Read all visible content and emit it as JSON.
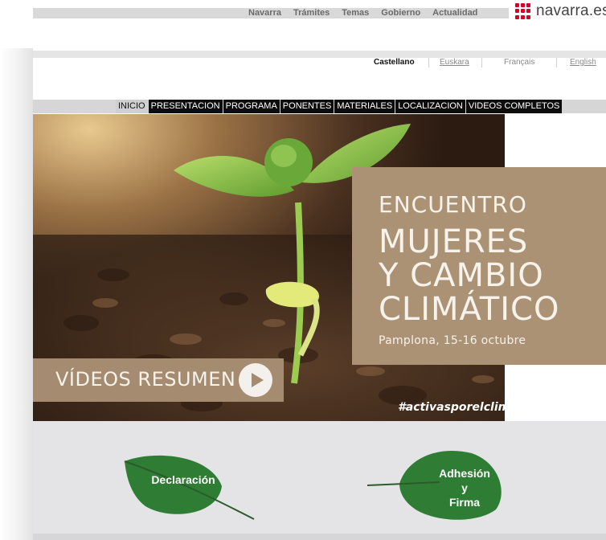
{
  "topnav": {
    "items": [
      "Navarra",
      "Trámites",
      "Temas",
      "Gobierno",
      "Actualidad"
    ]
  },
  "logo": {
    "text": "navarra.es",
    "icon": "navarra-dots-logo",
    "color": "#d80027"
  },
  "languages": {
    "current": "Castellano",
    "items": [
      "Euskara",
      "Français",
      "English"
    ]
  },
  "menu": {
    "items": [
      "INICIO",
      "PRESENTACION",
      "PROGRAMA",
      "PONENTES",
      "MATERIALES",
      "LOCALIZACION",
      "VIDEOS COMPLETOS"
    ]
  },
  "hero": {
    "event_label": "ENCUENTRO",
    "title_lines": [
      "MUJERES",
      "Y CAMBIO",
      "CLIMÁTICO"
    ],
    "place_date": "Pamplona, 15-16 octubre",
    "videos_label": "VÍDEOS RESUMEN",
    "play_icon": "play-icon",
    "hashtag": "#activasporelclima"
  },
  "links": {
    "declaracion": "Declaración",
    "adhesion_lines": [
      "Adhesión",
      "y",
      "Firma"
    ]
  }
}
